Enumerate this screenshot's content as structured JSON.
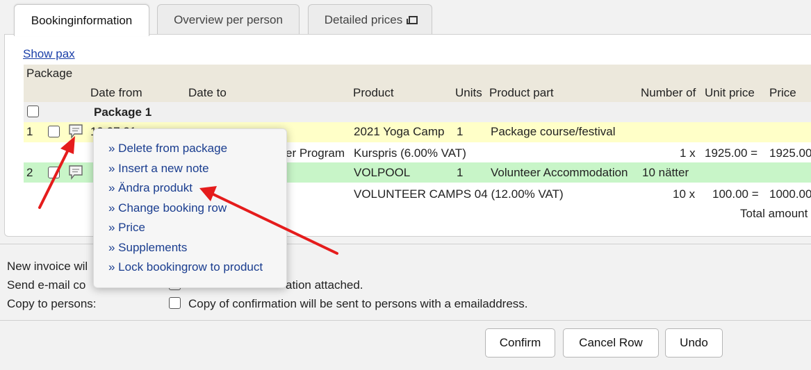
{
  "tabs": [
    {
      "label": "Bookinginformation",
      "active": true
    },
    {
      "label": "Overview per person",
      "active": false
    },
    {
      "label": "Detailed prices",
      "active": false,
      "icon": "popout-icon"
    }
  ],
  "show_pax": "Show pax",
  "table": {
    "package_label": "Package",
    "headers": {
      "date_from": "Date from",
      "date_to": "Date to",
      "product": "Product",
      "units": "Units",
      "product_part": "Product part",
      "number_of": "Number of",
      "unit_price": "Unit price",
      "price": "Price"
    },
    "group_name": "Package 1",
    "rows": [
      {
        "num": "1",
        "date_from": "19.07.21",
        "product": "2021 Yoga Camp",
        "units": "1",
        "product_part": "Package course/festival",
        "sub_partial": "er Program",
        "sub_product": "Kurspris (6.00% VAT)",
        "sub_qty": "1 x",
        "sub_unit_price": "1925.00 =",
        "sub_price": "1925.00"
      },
      {
        "num": "2",
        "product": "VOLPOOL",
        "units": "1",
        "product_part": "Volunteer Accommodation",
        "number_of": "10 nätter",
        "sub_product": "VOLUNTEER CAMPS 04 (12.00% VAT)",
        "sub_qty": "10 x",
        "sub_unit_price": "100.00 =",
        "sub_price": "1000.00"
      }
    ],
    "total_label": "Total amount"
  },
  "context_menu": {
    "items": [
      "» Delete from package",
      "» Insert a new note",
      "» Ändra produkt",
      "» Change booking row",
      "» Price",
      "» Supplements",
      "» Lock bookingrow to product"
    ]
  },
  "options": {
    "new_invoice_label": "New invoice wil",
    "send_email_label": "Send e-mail co",
    "send_email_text": "ation attached.",
    "copy_label": "Copy to persons:",
    "copy_text": "Copy of confirmation will be sent to persons with a emailaddress."
  },
  "buttons": {
    "confirm": "Confirm",
    "cancel_row": "Cancel Row",
    "undo": "Undo"
  },
  "colors": {
    "annotation_arrow": "#e51c1c",
    "row_yellow": "#ffffc8",
    "row_green": "#c8f5c8",
    "link": "#1a3fa8"
  }
}
